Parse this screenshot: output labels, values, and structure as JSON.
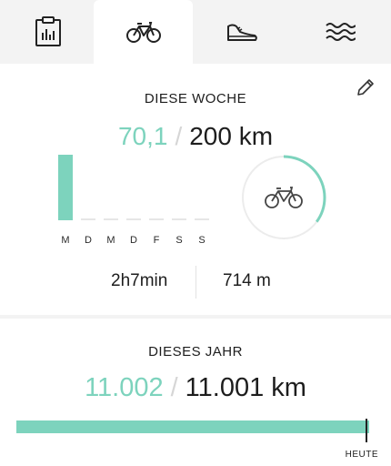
{
  "tabs": [
    {
      "icon": "clipboard-chart-icon",
      "active": false
    },
    {
      "icon": "bicycle-icon",
      "active": true
    },
    {
      "icon": "running-shoe-icon",
      "active": false
    },
    {
      "icon": "waves-icon",
      "active": false
    }
  ],
  "colors": {
    "accent": "#7dd3bd",
    "text": "#1d1d1d",
    "track": "#e9e9e9"
  },
  "week": {
    "title": "DIESE WOCHE",
    "current": "70,1",
    "separator": "/",
    "goal": "200 km",
    "edit_icon": "pencil-icon",
    "days": [
      "M",
      "D",
      "M",
      "D",
      "F",
      "S",
      "S"
    ],
    "day_distances": [
      70.1,
      0,
      0,
      0,
      0,
      0,
      0
    ],
    "progress_fraction": 0.3505,
    "ring_icon": "bicycle-icon",
    "duration": "2h7min",
    "elevation": "714 m"
  },
  "year": {
    "title": "DIESES JAHR",
    "current": "11.002",
    "separator": "/",
    "goal": "11.001 km",
    "progress_fraction": 1.0,
    "today_label": "HEUTE"
  }
}
